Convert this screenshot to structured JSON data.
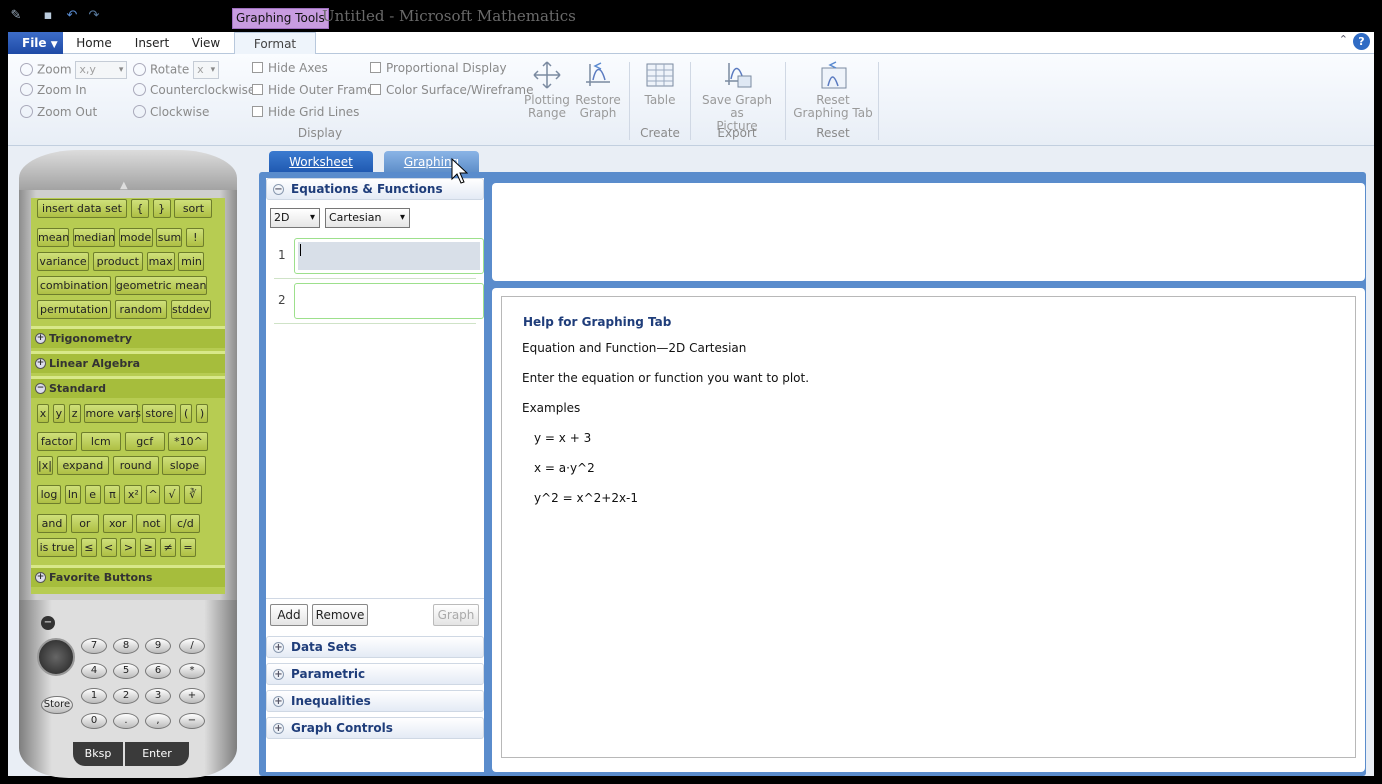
{
  "titlebar": {
    "contextual_tab": "Graphing Tools",
    "window_title": "Untitled - Microsoft Mathematics"
  },
  "ribbon_tabs": {
    "file": "File",
    "home": "Home",
    "insert": "Insert",
    "view": "View",
    "format": "Format"
  },
  "ribbon": {
    "zoom": "Zoom",
    "zoom_value": "x,y",
    "zoom_in": "Zoom In",
    "zoom_out": "Zoom Out",
    "rotate": "Rotate",
    "rotate_value": "x",
    "counterclockwise": "Counterclockwise",
    "clockwise": "Clockwise",
    "hide_axes": "Hide Axes",
    "hide_outer_frame": "Hide Outer Frame",
    "hide_grid_lines": "Hide Grid Lines",
    "proportional_display": "Proportional Display",
    "color_surface": "Color Surface/Wireframe",
    "display_group": "Display",
    "plotting_range": [
      "Plotting",
      "Range"
    ],
    "restore_graph": [
      "Restore",
      "Graph"
    ],
    "table": "Table",
    "create_group": "Create",
    "save_graph": [
      "Save Graph as",
      "Picture"
    ],
    "export_group": "Export",
    "reset_tab": [
      "Reset",
      "Graphing Tab"
    ],
    "reset_group": "Reset"
  },
  "calculator": {
    "rows": [
      [
        "insert data set",
        "{",
        "}",
        "sort"
      ],
      [
        "mean",
        "median",
        "mode",
        "sum",
        "!"
      ],
      [
        "variance",
        "product",
        "max",
        "min"
      ],
      [
        "combination",
        "geometric mean"
      ],
      [
        "permutation",
        "random",
        "stddev"
      ]
    ],
    "sections": {
      "trig": "Trigonometry",
      "linalg": "Linear Algebra",
      "standard": "Standard",
      "favorites": "Favorite Buttons"
    },
    "std_rows": [
      [
        "x",
        "y",
        "z",
        "more vars",
        "store",
        "(",
        ")"
      ],
      [
        "factor",
        "lcm",
        "gcf",
        "*10^"
      ],
      [
        "|x|",
        "expand",
        "round",
        "slope"
      ],
      [
        "log",
        "ln",
        "e",
        "π",
        "x²",
        "^",
        "√",
        "∛"
      ],
      [
        "and",
        "or",
        "xor",
        "not",
        "c/d"
      ],
      [
        "is true",
        "≤",
        "<",
        ">",
        "≥",
        "≠",
        "="
      ]
    ],
    "keypad": [
      "7",
      "8",
      "9",
      "/",
      "4",
      "5",
      "6",
      "*",
      "1",
      "2",
      "3",
      "+",
      "0",
      ".",
      ",",
      "−"
    ],
    "store": "Store",
    "bksp": "Bksp",
    "enter": "Enter"
  },
  "tabs": {
    "worksheet": "Worksheet",
    "graphing": "Graphing"
  },
  "panel": {
    "eq_header": "Equations & Functions",
    "dim": "2D",
    "coord": "Cartesian",
    "row1": "1",
    "row2": "2",
    "add": "Add",
    "remove": "Remove",
    "graph": "Graph",
    "data_sets": "Data Sets",
    "parametric": "Parametric",
    "inequalities": "Inequalities",
    "graph_controls": "Graph Controls"
  },
  "help": {
    "title": "Help for Graphing Tab",
    "subtitle": "Equation and Function—2D Cartesian",
    "intro": "Enter the equation or function you want to plot.",
    "examples_label": "Examples",
    "ex1": "y = x + 3",
    "ex2": "x = a·y^2",
    "ex3": "y^2 = x^2+2x-1"
  }
}
